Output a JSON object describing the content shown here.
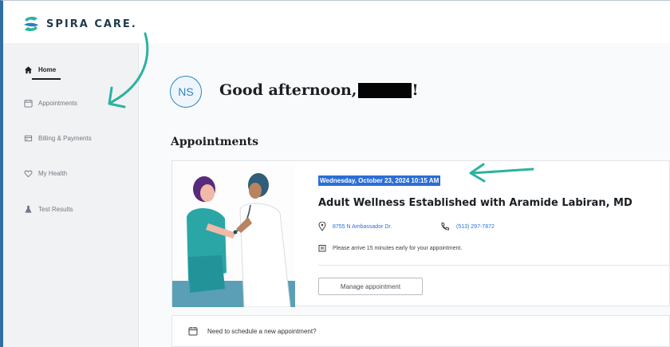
{
  "brand": {
    "name": "SPIRA CARE."
  },
  "sidebar": {
    "items": [
      {
        "label": "Home",
        "icon": "home-icon",
        "active": true
      },
      {
        "label": "Appointments",
        "icon": "calendar-icon"
      },
      {
        "label": "Billing & Payments",
        "icon": "billing-icon"
      },
      {
        "label": "My Health",
        "icon": "heart-icon"
      },
      {
        "label": "Test Results",
        "icon": "flask-icon"
      }
    ]
  },
  "main": {
    "avatar_initials": "NS",
    "greeting_prefix": "Good afternoon,",
    "greeting_suffix": "!",
    "section_title": "Appointments",
    "appointment": {
      "datetime": "Wednesday, October 23, 2024 10:15 AM",
      "title": "Adult Wellness Established with Aramide Labiran, MD",
      "location": "8755 N Ambassador Dr.",
      "phone": "(513) 297-7872",
      "note": "Please arrive 15 minutes early for your appointment.",
      "manage_label": "Manage appointment"
    },
    "schedule_prompt": "Need to schedule a new appointment?"
  },
  "colors": {
    "accent": "#2e86c1",
    "highlight": "#2b6ed6",
    "annotation": "#2ab3a0"
  }
}
